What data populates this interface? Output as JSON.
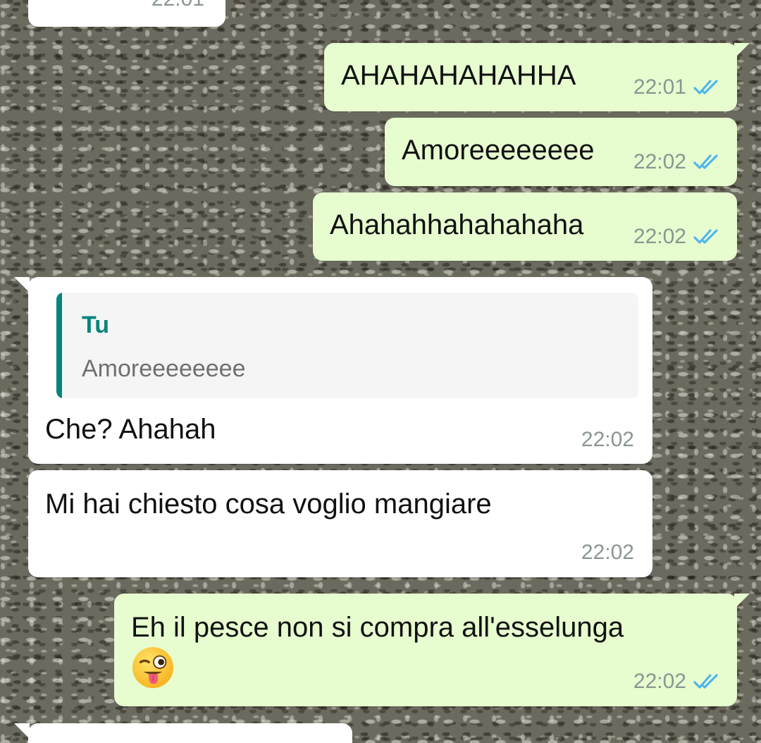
{
  "colors": {
    "outgoing_bubble": "#e7fccf",
    "incoming_bubble": "#ffffff",
    "quote_accent": "#06857a",
    "read_ticks": "#4fb6ec",
    "timestamp": "#8a9690"
  },
  "messages": [
    {
      "direction": "in",
      "text": "",
      "time": "22:01",
      "partial": true
    },
    {
      "direction": "out",
      "text": "AHAHAHAHAHHA",
      "time": "22:01",
      "status": "read"
    },
    {
      "direction": "out",
      "text": "Amoreeeeeeee",
      "time": "22:02",
      "status": "read"
    },
    {
      "direction": "out",
      "text": "Ahahahhahahahaha",
      "time": "22:02",
      "status": "read"
    },
    {
      "direction": "in",
      "reply_to": {
        "author": "Tu",
        "text": "Amoreeeeeeee"
      },
      "text": "Che? Ahahah",
      "time": "22:02"
    },
    {
      "direction": "in",
      "text": "Mi hai chiesto cosa voglio mangiare",
      "time": "22:02"
    },
    {
      "direction": "out",
      "text": "Eh il pesce non si compra all'esselunga",
      "emoji": "winking-face-with-tongue",
      "time": "22:02",
      "status": "read"
    },
    {
      "direction": "in",
      "text": "",
      "partial": true
    }
  ]
}
